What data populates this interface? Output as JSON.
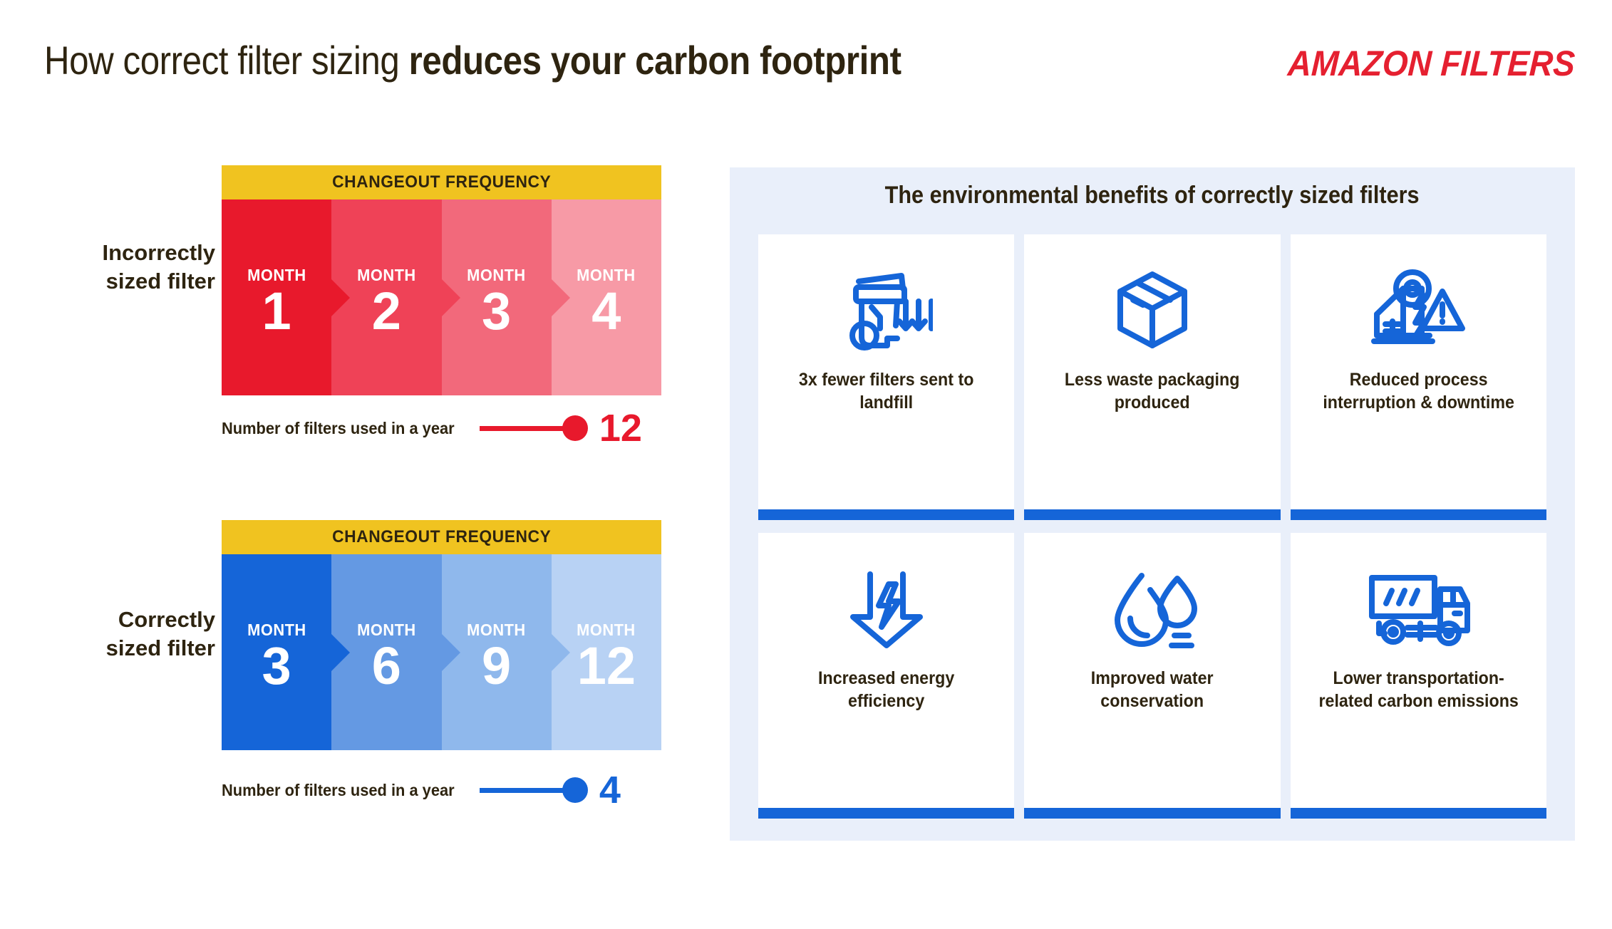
{
  "header": {
    "title_light": "How correct filter sizing ",
    "title_bold": "reduces your carbon footprint",
    "logo_part1": "AMAZON",
    "logo_part2": "FILTERS"
  },
  "colors": {
    "red": "#E8192C",
    "blue": "#1565D8",
    "yellow": "#F0C320",
    "panel_bg": "#E9EFFA",
    "text_dark": "#2e2410"
  },
  "left": {
    "incorrect": {
      "side_label": "Incorrectly\nsized filter",
      "header": "CHANGEOUT FREQUENCY",
      "month_word": "MONTH",
      "months": [
        "1",
        "2",
        "3",
        "4"
      ],
      "shades": [
        "#E8192C",
        "#EF4257",
        "#F2697B",
        "#F79AA6"
      ],
      "legend_text": "Number of filters used in a year",
      "legend_value": "12",
      "accent": "#E8192C"
    },
    "correct": {
      "side_label": "Correctly\nsized filter",
      "header": "CHANGEOUT FREQUENCY",
      "month_word": "MONTH",
      "months": [
        "3",
        "6",
        "9",
        "12"
      ],
      "shades": [
        "#1565D8",
        "#6499E3",
        "#8FB8EC",
        "#B8D2F4"
      ],
      "legend_text": "Number of filters used in a year",
      "legend_value": "4",
      "accent": "#1565D8"
    }
  },
  "panel": {
    "title": "The environmental benefits of correctly sized filters",
    "cards": [
      {
        "icon": "waste-bin-icon",
        "label": "3x fewer filters sent to landfill"
      },
      {
        "icon": "package-box-icon",
        "label": "Less waste packaging produced"
      },
      {
        "icon": "factory-warning-icon",
        "label": "Reduced process interruption & downtime"
      },
      {
        "icon": "energy-arrow-icon",
        "label": "Increased energy efficiency"
      },
      {
        "icon": "water-drop-icon",
        "label": "Improved water conservation"
      },
      {
        "icon": "delivery-truck-icon",
        "label": "Lower transportation-related carbon emissions"
      }
    ]
  }
}
